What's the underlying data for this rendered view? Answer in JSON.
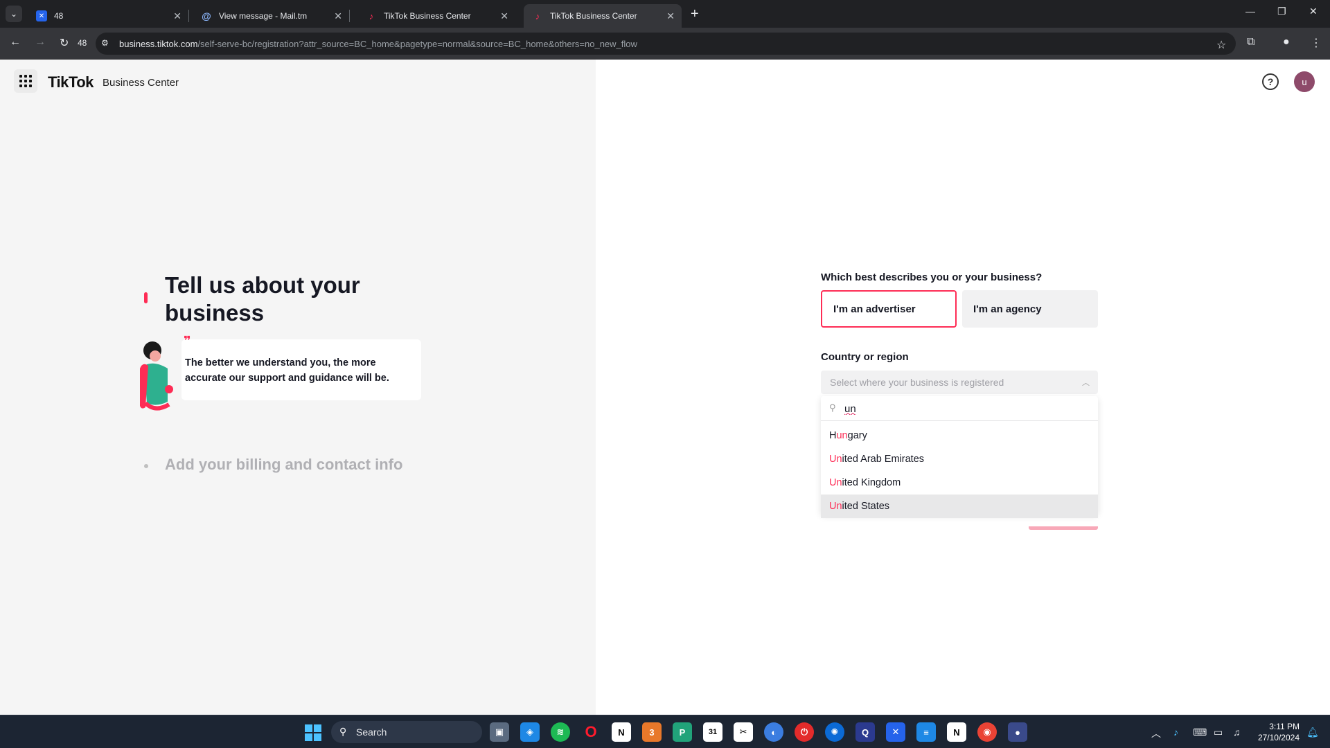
{
  "browser": {
    "tabs": [
      {
        "title": "48",
        "icon": "cross-app-icon",
        "active": false
      },
      {
        "title": "View message - Mail.tm",
        "icon": "at-icon",
        "active": false
      },
      {
        "title": "TikTok Business Center",
        "icon": "tiktok-icon",
        "active": false
      },
      {
        "title": "TikTok Business Center",
        "icon": "tiktok-icon",
        "active": true
      }
    ],
    "reload_badge": "48",
    "url_domain": "business.tiktok.com",
    "url_path": "/self-serve-bc/registration?attr_source=BC_home&pagetype=normal&source=BC_home&others=no_new_flow"
  },
  "header": {
    "logo": "TikTok",
    "logo_sub": "Business Center",
    "avatar_letter": "u"
  },
  "steps": {
    "current_title": "Tell us about your business",
    "tip": "The better we understand you, the more accurate our support and guidance will be.",
    "next_title": "Add your billing and contact info"
  },
  "form": {
    "question": "Which best describes you or your business?",
    "option_advertiser": "I'm an advertiser",
    "option_agency": "I'm an agency",
    "country_label": "Country or region",
    "country_placeholder": "Select where your business is registered",
    "search_value": "un",
    "results": [
      {
        "pre": "H",
        "match": "un",
        "post": "gary"
      },
      {
        "pre": "",
        "match": "Un",
        "post": "ited Arab Emirates"
      },
      {
        "pre": "",
        "match": "Un",
        "post": "ited Kingdom"
      },
      {
        "pre": "",
        "match": "Un",
        "post": "ited States"
      }
    ]
  },
  "taskbar": {
    "search_label": "Search",
    "time": "3:11 PM",
    "date": "27/10/2024"
  },
  "colors": {
    "accent": "#fe2c55",
    "left_pane": "#f5f5f5"
  }
}
